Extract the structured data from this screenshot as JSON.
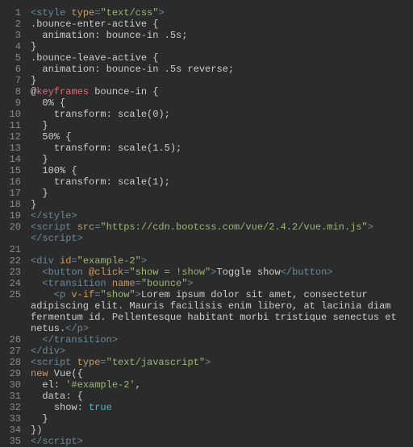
{
  "code": {
    "lines": [
      [
        {
          "cls": "tk-tag",
          "t": "<style "
        },
        {
          "cls": "tk-attr",
          "t": "type"
        },
        {
          "cls": "tk-tag",
          "t": "="
        },
        {
          "cls": "tk-string",
          "t": "\"text/css\""
        },
        {
          "cls": "tk-tag",
          "t": ">"
        }
      ],
      [
        {
          "cls": "tk-default",
          "t": ".bounce-enter-active {"
        }
      ],
      [
        {
          "cls": "tk-default",
          "t": "  animation: bounce-in .5s;"
        }
      ],
      [
        {
          "cls": "tk-default",
          "t": "}"
        }
      ],
      [
        {
          "cls": "tk-default",
          "t": ".bounce-leave-active {"
        }
      ],
      [
        {
          "cls": "tk-default",
          "t": "  animation: bounce-in .5s reverse;"
        }
      ],
      [
        {
          "cls": "tk-default",
          "t": "}"
        }
      ],
      [
        {
          "cls": "tk-break",
          "t": "@"
        },
        {
          "cls": "tk-key",
          "t": "keyframes"
        },
        {
          "cls": "tk-default",
          "t": " bounce-in {"
        }
      ],
      [
        {
          "cls": "tk-default",
          "t": "  0% {"
        }
      ],
      [
        {
          "cls": "tk-default",
          "t": "    transform: scale(0);"
        }
      ],
      [
        {
          "cls": "tk-default",
          "t": "  }"
        }
      ],
      [
        {
          "cls": "tk-default",
          "t": "  50% {"
        }
      ],
      [
        {
          "cls": "tk-default",
          "t": "    transform: scale(1.5);"
        }
      ],
      [
        {
          "cls": "tk-default",
          "t": "  }"
        }
      ],
      [
        {
          "cls": "tk-default",
          "t": "  100% {"
        }
      ],
      [
        {
          "cls": "tk-default",
          "t": "    transform: scale(1);"
        }
      ],
      [
        {
          "cls": "tk-default",
          "t": "  }"
        }
      ],
      [
        {
          "cls": "tk-default",
          "t": "}"
        }
      ],
      [
        {
          "cls": "tk-tag",
          "t": "</style>"
        }
      ],
      [
        {
          "cls": "tk-tag",
          "t": "<script "
        },
        {
          "cls": "tk-attr",
          "t": "src"
        },
        {
          "cls": "tk-tag",
          "t": "="
        },
        {
          "cls": "tk-string",
          "t": "\"https://cdn.bootcss.com/vue/2.4.2/vue.min.js\""
        },
        {
          "cls": "tk-tag",
          "t": "></script>"
        }
      ],
      [
        {
          "cls": "tk-default",
          "t": " "
        }
      ],
      [
        {
          "cls": "tk-tag",
          "t": "<div "
        },
        {
          "cls": "tk-attr",
          "t": "id"
        },
        {
          "cls": "tk-tag",
          "t": "="
        },
        {
          "cls": "tk-string",
          "t": "\"example-2\""
        },
        {
          "cls": "tk-tag",
          "t": ">"
        }
      ],
      [
        {
          "cls": "tk-tag",
          "t": "  <button "
        },
        {
          "cls": "tk-attr",
          "t": "@click"
        },
        {
          "cls": "tk-tag",
          "t": "="
        },
        {
          "cls": "tk-string",
          "t": "\"show = !show\""
        },
        {
          "cls": "tk-tag",
          "t": ">"
        },
        {
          "cls": "tk-default",
          "t": "Toggle show"
        },
        {
          "cls": "tk-tag",
          "t": "</button>"
        }
      ],
      [
        {
          "cls": "tk-tag",
          "t": "  <transition "
        },
        {
          "cls": "tk-attr",
          "t": "name"
        },
        {
          "cls": "tk-tag",
          "t": "="
        },
        {
          "cls": "tk-string",
          "t": "\"bounce\""
        },
        {
          "cls": "tk-tag",
          "t": ">"
        }
      ],
      [
        {
          "cls": "tk-tag",
          "t": "    <p "
        },
        {
          "cls": "tk-attr",
          "t": "v-if"
        },
        {
          "cls": "tk-tag",
          "t": "="
        },
        {
          "cls": "tk-string",
          "t": "\"show\""
        },
        {
          "cls": "tk-tag",
          "t": ">"
        },
        {
          "cls": "tk-default",
          "t": "Lorem ipsum dolor sit amet, consectetur adipiscing elit. Mauris facilisis enim libero, at lacinia diam fermentum id. Pellentesque habitant morbi tristique senectus et netus."
        },
        {
          "cls": "tk-tag",
          "t": "</p>"
        }
      ],
      [
        {
          "cls": "tk-tag",
          "t": "  </transition>"
        }
      ],
      [
        {
          "cls": "tk-tag",
          "t": "</div>"
        }
      ],
      [
        {
          "cls": "tk-tag",
          "t": "<script "
        },
        {
          "cls": "tk-attr",
          "t": "type"
        },
        {
          "cls": "tk-tag",
          "t": "="
        },
        {
          "cls": "tk-string",
          "t": "\"text/javascript\""
        },
        {
          "cls": "tk-tag",
          "t": ">"
        }
      ],
      [
        {
          "cls": "tk-new",
          "t": "new"
        },
        {
          "cls": "tk-default",
          "t": " Vue({"
        }
      ],
      [
        {
          "cls": "tk-default",
          "t": "  el: "
        },
        {
          "cls": "tk-string",
          "t": "'#example-2'"
        },
        {
          "cls": "tk-default",
          "t": ","
        }
      ],
      [
        {
          "cls": "tk-default",
          "t": "  data: {"
        }
      ],
      [
        {
          "cls": "tk-default",
          "t": "    show: "
        },
        {
          "cls": "tk-bool",
          "t": "true"
        }
      ],
      [
        {
          "cls": "tk-default",
          "t": "  }"
        }
      ],
      [
        {
          "cls": "tk-default",
          "t": "})"
        }
      ],
      [
        {
          "cls": "tk-tag",
          "t": "</script>"
        }
      ]
    ]
  }
}
